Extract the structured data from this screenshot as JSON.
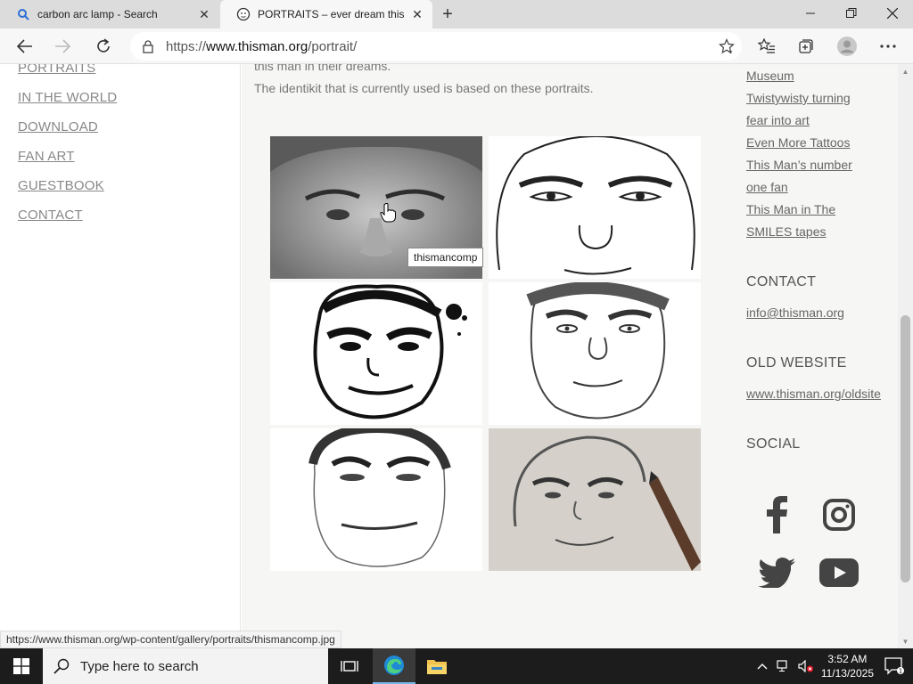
{
  "browser": {
    "tabs": [
      {
        "title": "carbon arc lamp - Search",
        "active": false
      },
      {
        "title": "PORTRAITS – ever dream this man",
        "active": true
      }
    ],
    "url": {
      "scheme": "https://",
      "host": "www.thisman.org",
      "path": "/portrait/"
    }
  },
  "nav": {
    "links": [
      "PORTRAITS",
      "IN THE WORLD",
      "DOWNLOAD",
      "FAN ART",
      "GUESTBOOK",
      "CONTACT"
    ]
  },
  "content": {
    "line1": "this man in their dreams.",
    "line2": "The identikit that is currently used is based on these portraits.",
    "tooltip": "thismancomp"
  },
  "sidebar": {
    "links": [
      "Museum",
      "Twistywisty turning",
      "fear into art",
      "Even More Tattoos",
      "This Man’s number",
      "one fan",
      "This Man in The",
      "SMILES tapes"
    ],
    "contact_heading": "CONTACT",
    "contact_email": "info@thisman.org",
    "old_heading": "OLD WEBSITE",
    "old_link": "www.thisman.org/oldsite",
    "social_heading": "SOCIAL",
    "social_icons": [
      "facebook-icon",
      "instagram-icon",
      "twitter-icon",
      "youtube-icon"
    ]
  },
  "status_bar": {
    "url": "https://www.thisman.org/wp-content/gallery/portraits/thismancomp.jpg"
  },
  "taskbar": {
    "search_placeholder": "Type here to search",
    "time": "3:52 AM",
    "date": "11/13/2025"
  }
}
